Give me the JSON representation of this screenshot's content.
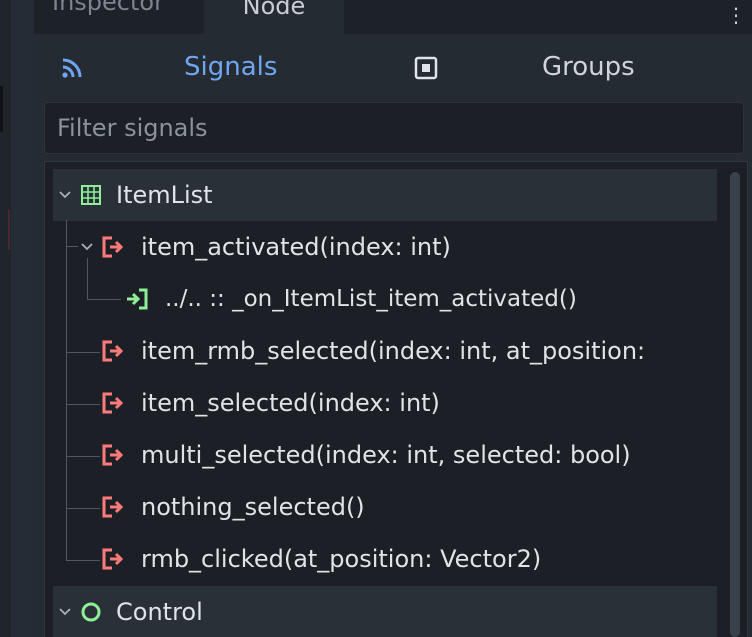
{
  "dock": {
    "tabs": [
      "Inspector",
      "Node"
    ],
    "active_tab": "Node",
    "menu_icon": "kebab-menu-icon"
  },
  "toolbar": {
    "signals_label": "Signals",
    "signals_icon": "signal-icon",
    "groups_label": "Groups",
    "groups_icon": "group-icon",
    "accent_color": "#6fa6ef"
  },
  "filter": {
    "placeholder": "Filter signals",
    "value": ""
  },
  "tree": {
    "sections": [
      {
        "name": "ItemList",
        "icon": "itemlist-icon",
        "expanded": true,
        "signals": [
          {
            "label": "item_activated(index: int)",
            "icon": "signal-emit-icon",
            "expanded": true,
            "connections": [
              {
                "label": "../.. :: _on_ItemList_item_activated()",
                "icon": "slot-connection-icon"
              }
            ]
          },
          {
            "label": "item_rmb_selected(index: int, at_position:",
            "icon": "signal-emit-icon"
          },
          {
            "label": "item_selected(index: int)",
            "icon": "signal-emit-icon"
          },
          {
            "label": "multi_selected(index: int, selected: bool)",
            "icon": "signal-emit-icon"
          },
          {
            "label": "nothing_selected()",
            "icon": "signal-emit-icon"
          },
          {
            "label": "rmb_clicked(at_position: Vector2)",
            "icon": "signal-emit-icon"
          }
        ]
      },
      {
        "name": "Control",
        "icon": "control-icon",
        "expanded": true,
        "signals": []
      }
    ],
    "colors": {
      "signal_icon": "#ff7a7a",
      "connection_icon": "#8eef97",
      "itemlist_icon": "#8eef97",
      "control_icon": "#8eef97"
    }
  }
}
